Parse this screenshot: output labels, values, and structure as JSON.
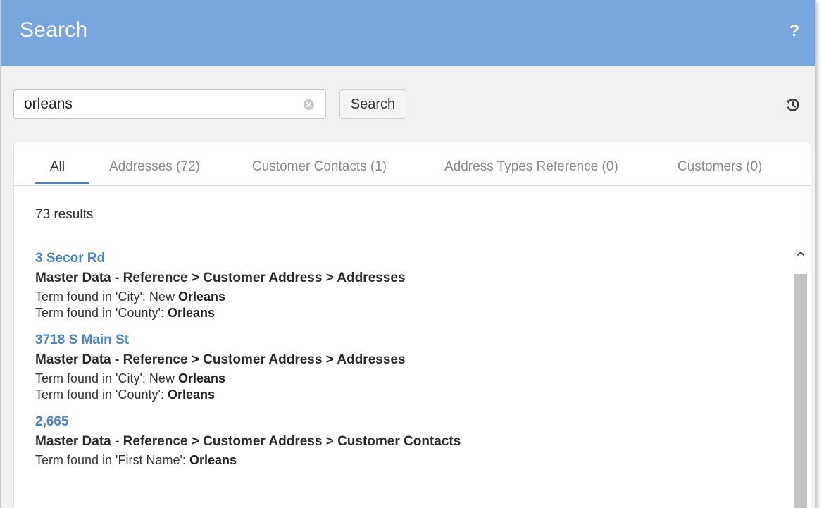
{
  "header": {
    "title": "Search",
    "help_label": "?"
  },
  "search": {
    "value": "orleans",
    "button_label": "Search"
  },
  "tabs": [
    {
      "label": "All",
      "active": true
    },
    {
      "label": "Addresses (72)",
      "active": false
    },
    {
      "label": "Customer Contacts (1)",
      "active": false
    },
    {
      "label": "Address Types Reference (0)",
      "active": false
    },
    {
      "label": "Customers (0)",
      "active": false
    }
  ],
  "result_count": "73 results",
  "results": [
    {
      "title": "3 Secor Rd",
      "path": "Master Data - Reference > Customer Address > Addresses",
      "matches": [
        {
          "prefix": "Term found in 'City': New ",
          "term": "Orleans"
        },
        {
          "prefix": "Term found in 'County': ",
          "term": "Orleans"
        }
      ]
    },
    {
      "title": "3718 S Main St",
      "path": "Master Data - Reference > Customer Address > Addresses",
      "matches": [
        {
          "prefix": "Term found in 'City': New ",
          "term": "Orleans"
        },
        {
          "prefix": "Term found in 'County': ",
          "term": "Orleans"
        }
      ]
    },
    {
      "title": "2,665",
      "path": "Master Data - Reference > Customer Address > Customer Contacts",
      "matches": [
        {
          "prefix": "Term found in 'First Name': ",
          "term": "Orleans"
        }
      ]
    }
  ],
  "colors": {
    "header": "#79a6dc",
    "link": "#4a82c9",
    "tab_underline": "#4a7fc1"
  },
  "icons": {
    "clear": "clear-circle-icon",
    "history": "history-icon",
    "scroll_up": "chevron-up-icon"
  }
}
